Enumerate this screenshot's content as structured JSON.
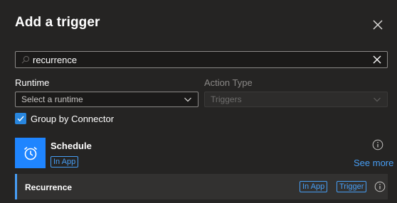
{
  "panel": {
    "title": "Add a trigger",
    "close_icon": "close-icon"
  },
  "search": {
    "value": "recurrence",
    "placeholder": "Search",
    "icon": "search-icon",
    "clear_icon": "close-icon"
  },
  "filters": {
    "runtime_label": "Runtime",
    "runtime_placeholder": "Select a runtime",
    "action_type_label": "Action Type",
    "action_type_value": "Triggers",
    "group_by_connector_label": "Group by Connector",
    "group_by_connector_checked": true
  },
  "connector": {
    "name": "Schedule",
    "badge": "In App",
    "icon": "alarm-clock-icon",
    "icon_color": "#1f85ff",
    "see_more": "See more"
  },
  "operations": [
    {
      "name": "Recurrence",
      "badges": [
        "In App",
        "Trigger"
      ]
    }
  ],
  "colors": {
    "background": "#252423",
    "accent": "#479ef5",
    "checkbox": "#2886de",
    "row_background": "#323130"
  }
}
